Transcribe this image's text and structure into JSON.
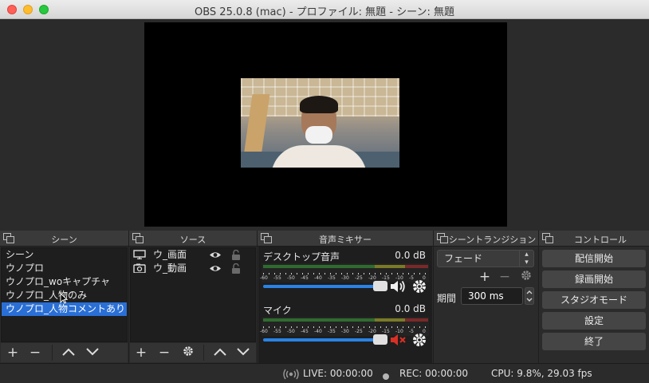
{
  "window": {
    "title": "OBS 25.0.8 (mac) - プロファイル: 無題 - シーン: 無題"
  },
  "scenes": {
    "title": "シーン",
    "items": [
      {
        "label": "シーン",
        "selected": false
      },
      {
        "label": "ウノプロ",
        "selected": false
      },
      {
        "label": "ウノプロ_woキャプチャ",
        "selected": false
      },
      {
        "label": "ウノプロ_人物のみ",
        "selected": false
      },
      {
        "label": "ウノプロ_人物コメントあり",
        "selected": true
      }
    ]
  },
  "sources": {
    "title": "ソース",
    "items": [
      {
        "label": "ウ_画面",
        "icon": "monitor-icon"
      },
      {
        "label": "ウ_動画",
        "icon": "camera-icon"
      }
    ]
  },
  "mixer": {
    "title": "音声ミキサー",
    "tick_labels": [
      "-60",
      "-55",
      "-50",
      "-45",
      "-40",
      "-35",
      "-30",
      "-25",
      "-20",
      "-15",
      "-10",
      "-5",
      "0"
    ],
    "channels": [
      {
        "name": "デスクトップ音声",
        "db": "0.0 dB",
        "muted": false
      },
      {
        "name": "マイク",
        "db": "0.0 dB",
        "muted": true
      }
    ]
  },
  "transitions": {
    "title": "シーントランジション",
    "selected": "フェード",
    "duration_label": "期間",
    "duration_value": "300 ms"
  },
  "controls": {
    "title": "コントロール",
    "buttons": [
      "配信開始",
      "録画開始",
      "スタジオモード",
      "設定",
      "終了"
    ]
  },
  "status": {
    "live": "LIVE: 00:00:00",
    "rec": "REC: 00:00:00",
    "cpu": "CPU: 9.8%, 29.03 fps"
  },
  "colors": {
    "selection": "#2a6fd6",
    "slider": "#2a82e4",
    "muted": "#d93025"
  }
}
